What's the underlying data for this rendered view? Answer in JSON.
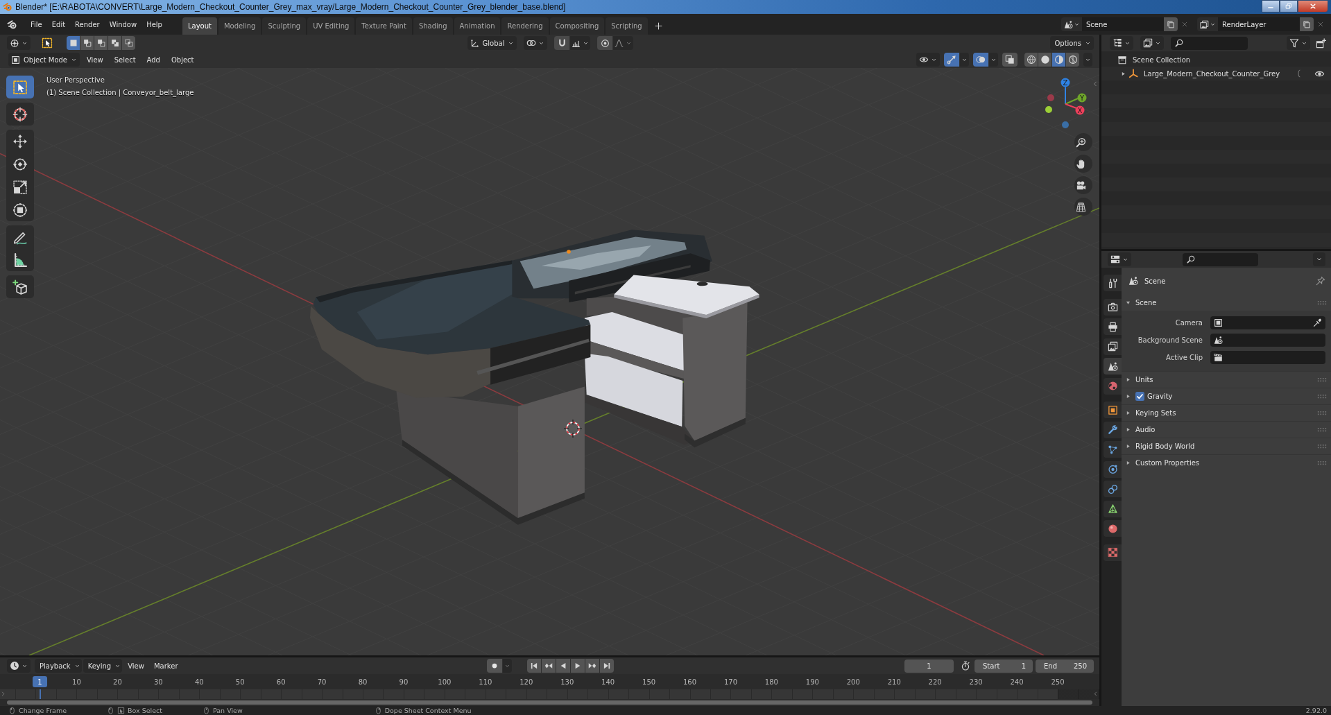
{
  "window": {
    "title": "Blender* [E:\\RABOTA\\CONVERT\\Large_Modern_Checkout_Counter_Grey_max_vray/Large_Modern_Checkout_Counter_Grey_blender_base.blend]"
  },
  "menu": [
    "File",
    "Edit",
    "Render",
    "Window",
    "Help"
  ],
  "workspaces": [
    {
      "label": "Layout",
      "selected": true
    },
    {
      "label": "Modeling",
      "selected": false
    },
    {
      "label": "Sculpting",
      "selected": false
    },
    {
      "label": "UV Editing",
      "selected": false
    },
    {
      "label": "Texture Paint",
      "selected": false
    },
    {
      "label": "Shading",
      "selected": false
    },
    {
      "label": "Animation",
      "selected": false
    },
    {
      "label": "Rendering",
      "selected": false
    },
    {
      "label": "Compositing",
      "selected": false
    },
    {
      "label": "Scripting",
      "selected": false
    }
  ],
  "scene": {
    "value": "Scene"
  },
  "view_layer": {
    "value": "RenderLayer"
  },
  "tool_header": {
    "select_modes": [
      {
        "kind": "set",
        "selected": true
      },
      {
        "kind": "extend",
        "selected": false
      },
      {
        "kind": "subtract",
        "selected": false
      },
      {
        "kind": "difference",
        "selected": false
      },
      {
        "kind": "intersect",
        "selected": false
      }
    ],
    "orientation": "Global",
    "options": "Options"
  },
  "viewport": {
    "mode": "Object Mode",
    "menus": [
      "View",
      "Select",
      "Add",
      "Object"
    ],
    "toggles": [
      {
        "kind": "gizmos",
        "on": true
      },
      {
        "kind": "overlays",
        "on": true
      },
      {
        "kind": "xray",
        "on": false
      }
    ],
    "shading": [
      {
        "kind": "wireframe",
        "selected": false
      },
      {
        "kind": "solid",
        "selected": false
      },
      {
        "kind": "material",
        "selected": true
      },
      {
        "kind": "rendered",
        "selected": false
      }
    ],
    "tools": [
      {
        "kind": "select",
        "selected": true
      },
      {
        "kind": "cursor",
        "selected": false
      },
      {
        "kind": "move",
        "selected": false
      },
      {
        "kind": "rotate",
        "selected": false
      },
      {
        "kind": "scale",
        "selected": false
      },
      {
        "kind": "transform",
        "selected": false
      },
      {
        "kind": "annotate",
        "selected": false
      },
      {
        "kind": "measure",
        "selected": false
      },
      {
        "kind": "add_cube",
        "selected": false
      }
    ],
    "info": [
      "User Perspective",
      "(1) Scene Collection | Conveyor_belt_large"
    ],
    "gizmo_labels": [
      "Z",
      "Y",
      "X"
    ]
  },
  "outliner": {
    "tree": [
      {
        "label": "Scene Collection",
        "kind": "collection",
        "children": [
          {
            "label": "Large_Modern_Checkout_Counter_Grey",
            "kind": "empty",
            "expanded": false,
            "visible": true
          }
        ]
      }
    ]
  },
  "properties": {
    "tabs": [
      {
        "kind": "tool",
        "selected": false
      },
      {
        "kind": "render",
        "selected": false
      },
      {
        "kind": "output",
        "selected": false
      },
      {
        "kind": "view_layer",
        "selected": false
      },
      {
        "kind": "scene",
        "selected": true
      },
      {
        "kind": "world",
        "selected": false
      },
      {
        "kind": "object",
        "selected": false
      },
      {
        "kind": "modifiers",
        "selected": false
      },
      {
        "kind": "particles",
        "selected": false
      },
      {
        "kind": "physics",
        "selected": false
      },
      {
        "kind": "constraints",
        "selected": false
      },
      {
        "kind": "data",
        "selected": false
      },
      {
        "kind": "material",
        "selected": false
      },
      {
        "kind": "texture",
        "selected": false
      }
    ],
    "context": "Scene",
    "panel": {
      "title": "Scene",
      "expanded": true,
      "fields": [
        {
          "label": "Camera",
          "kind": "object"
        },
        {
          "label": "Background Scene",
          "kind": "scene"
        },
        {
          "label": "Active Clip",
          "kind": "clip"
        }
      ]
    },
    "subpanels": [
      {
        "label": "Units",
        "kind": "plain",
        "expanded": false
      },
      {
        "label": "Gravity",
        "kind": "checkbox",
        "expanded": false,
        "checked": true
      },
      {
        "label": "Keying Sets",
        "kind": "plain",
        "expanded": false
      },
      {
        "label": "Audio",
        "kind": "plain",
        "expanded": false
      },
      {
        "label": "Rigid Body World",
        "kind": "plain",
        "expanded": false
      },
      {
        "label": "Custom Properties",
        "kind": "plain",
        "expanded": false
      }
    ]
  },
  "timeline": {
    "menus": [
      {
        "label": "Playback",
        "kind": "dropdown"
      },
      {
        "label": "Keying",
        "kind": "dropdown"
      },
      {
        "label": "View",
        "kind": "menu"
      },
      {
        "label": "Marker",
        "kind": "menu"
      }
    ],
    "auto_keying": false,
    "current_frame": "1",
    "start": {
      "label": "Start",
      "value": "1"
    },
    "end": {
      "label": "End",
      "value": "250"
    },
    "playhead": "1",
    "ruler": [
      "10",
      "20",
      "30",
      "40",
      "50",
      "60",
      "70",
      "80",
      "90",
      "100",
      "110",
      "120",
      "130",
      "140",
      "150",
      "160",
      "170",
      "180",
      "190",
      "200",
      "210",
      "220",
      "230",
      "240",
      "250"
    ]
  },
  "status_bar": {
    "hints": [
      "Change Frame",
      "Box Select",
      "Pan View",
      "Dope Sheet Context Menu"
    ],
    "version": "2.92.0"
  }
}
